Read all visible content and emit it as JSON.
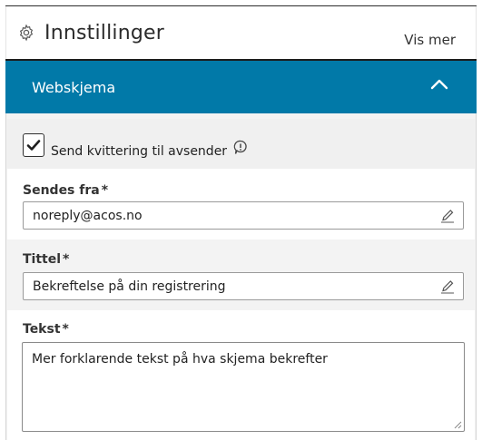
{
  "header": {
    "title": "Innstillinger",
    "more_link": "Vis mer"
  },
  "section": {
    "title": "Webskjema",
    "expanded": true
  },
  "form": {
    "receipt_checkbox": {
      "label": "Send kvittering til avsender",
      "checked": true
    },
    "sender": {
      "label": "Sendes fra",
      "required_mark": "*",
      "value": "noreply@acos.no"
    },
    "title_field": {
      "label": "Tittel",
      "required_mark": "*",
      "value": "Bekreftelse på din registrering"
    },
    "text_field": {
      "label": "Tekst",
      "required_mark": "*",
      "value": "Mer forklarende tekst på hva skjema bekrefter"
    }
  },
  "colors": {
    "section_bar": "#0179a8",
    "panel_bg": "#f3f3f3"
  }
}
